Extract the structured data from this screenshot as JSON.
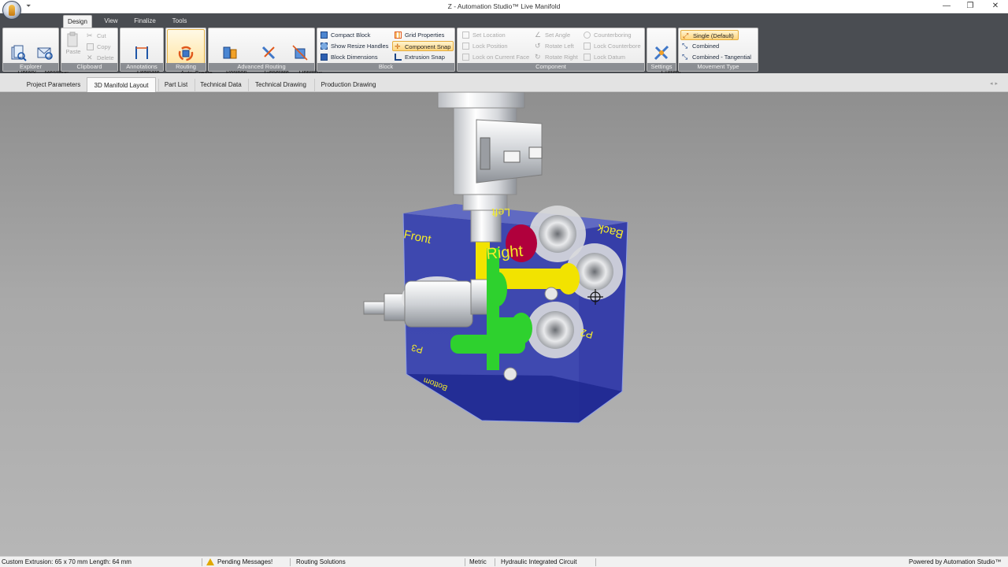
{
  "window": {
    "title": "Z - Automation Studio™ Live Manifold",
    "qat": "⏷",
    "min": "—",
    "max": "❐",
    "close": "✕"
  },
  "ribbon_tabs": [
    "Design",
    "View",
    "Finalize",
    "Tools"
  ],
  "ribbon": {
    "explorer": {
      "caption": "Explorer",
      "library": "Library\nExplorer",
      "message": "Message\nExplorer"
    },
    "clipboard": {
      "caption": "Clipboard",
      "paste": "Paste",
      "cut": "Cut",
      "copy": "Copy",
      "delete": "Delete"
    },
    "annotations": {
      "caption": "Annotations",
      "ordinate": "Ordinate\nDimensions ▾"
    },
    "routing": {
      "caption": "Routing",
      "auto_create": "Auto-Create\nBlock"
    },
    "advanced_routing": {
      "caption": "Advanced Routing",
      "position": "Position\nComponents ▾",
      "generate": "Generate\nChannels ▾",
      "optimize": "Optimize\nBlock ▾"
    },
    "block": {
      "caption": "Block",
      "compact": "Compact Block",
      "resize": "Show Resize Handles",
      "dimensions": "Block Dimensions",
      "grid": "Grid Properties",
      "snap": "Component Snap",
      "extrusion": "Extrusion Snap"
    },
    "component": {
      "caption": "Component",
      "set_location": "Set Location",
      "lock_position": "Lock Position",
      "lock_face": "Lock on Current Face",
      "set_angle": "Set Angle",
      "rotate_left": "Rotate Left",
      "rotate_right": "Rotate Right",
      "counterboring": "Counterboring",
      "lock_counterbore": "Lock Counterbore",
      "lock_datum": "Lock Datum"
    },
    "settings": {
      "caption": "Settings",
      "current": "Current\nOptions"
    },
    "movement": {
      "caption": "Movement Type",
      "single": "Single (Default)",
      "combined": "Combined",
      "tangential": "Combined - Tangential"
    }
  },
  "doc_tabs": [
    "Project Parameters",
    "3D Manifold Layout",
    "Part List",
    "Technical Data",
    "Technical Drawing",
    "Production Drawing"
  ],
  "doc_arrows": "◂▸",
  "scene": {
    "faces": {
      "front": "Front",
      "left": "Left",
      "right": "Right",
      "back": "Back",
      "p2": "P2",
      "p3": "P3",
      "bottom": "Bottom"
    }
  },
  "status": {
    "extrusion": "Custom Extrusion: 65 x 70 mm   Length: 64 mm",
    "pending": "Pending Messages!",
    "routing": "Routing Solutions",
    "units": "Metric",
    "circuit": "Hydraulic Integrated Circuit",
    "powered": "Powered by Automation Studio™"
  },
  "colors": {
    "accent": "#f7c65a",
    "block": "#2a33a8",
    "channel_green": "#2ed12e",
    "channel_yellow": "#f2e300",
    "channel_red": "#b0003c"
  }
}
